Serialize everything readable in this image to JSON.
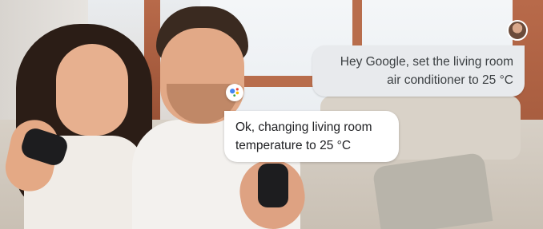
{
  "conversation": {
    "user_message": {
      "lines": [
        "Hey Google, set the living room",
        "air conditioner to 25 °C"
      ]
    },
    "assistant_message": {
      "lines": [
        "Ok, changing living room",
        "temperature to 25 °C"
      ]
    }
  },
  "icons": {
    "user_avatar": "user-avatar",
    "assistant": "google-assistant-icon"
  },
  "colors": {
    "user_bubble": "#e8eaed",
    "assistant_bubble": "#ffffff",
    "assistant_blue": "#4285f4",
    "assistant_red": "#ea4335",
    "assistant_yellow": "#fbbc05",
    "assistant_green": "#34a853"
  }
}
